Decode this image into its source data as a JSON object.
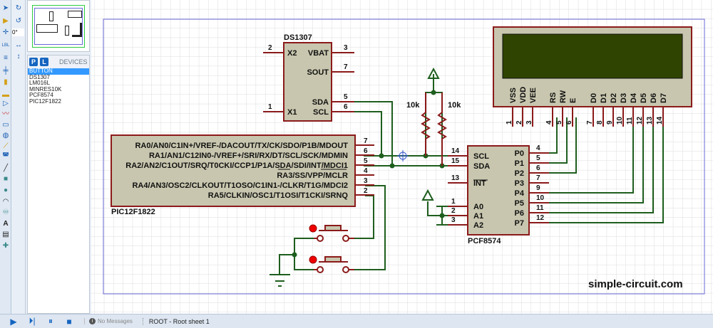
{
  "devices": {
    "title": "DEVICES",
    "p_label": "P",
    "l_label": "L",
    "items": [
      "BUTTON",
      "DS1307",
      "LM016L",
      "MINRES10K",
      "PCF8574",
      "PIC12F1822"
    ],
    "selected": "BUTTON"
  },
  "rotation": "0°",
  "status": {
    "messages": "No Messages",
    "sheet": "ROOT - Root sheet 1"
  },
  "watermark": "simple-circuit.com",
  "colors": {
    "pin": "#8b1a1a",
    "wire": "#1e5e1e",
    "body": "#c8c6ae",
    "lcd_screen": "#2f4400",
    "sheet_border": "#6a6ad8"
  },
  "pic": {
    "name": "PIC12F1822",
    "pins": [
      {
        "label": "RA0/AN0/C1IN+/VREF-/DACOUT/TX/CK/SDO/P1B/MDOUT",
        "num": "7"
      },
      {
        "label": "RA1/AN1/C12IN0-/VREF+/SRI/RX/DT/SCL/SCK/MDMIN",
        "num": "6"
      },
      {
        "label": "RA2/AN2/C1OUT/SRQ/T0CKI/CCP1/P1A/SDA/SDI/INT/MDCI1",
        "num": "5"
      },
      {
        "label": "RA3/SS/VPP/MCLR",
        "num": "4"
      },
      {
        "label": "RA4/AN3/OSC2/CLKOUT/T1OSO/C1IN1-/CLKR/T1G/MDCI2",
        "num": "3"
      },
      {
        "label": "RA5/CLKIN/OSC1/T1OSI/T1CKI/SRNQ",
        "num": "2"
      }
    ]
  },
  "ds1307": {
    "name": "DS1307",
    "left": [
      {
        "label": "X2",
        "num": "2"
      },
      {
        "label": "X1",
        "num": "1"
      }
    ],
    "right": [
      {
        "label": "VBAT",
        "num": "3"
      },
      {
        "label": "SOUT",
        "num": "7"
      },
      {
        "label": "SDA",
        "num": "5"
      },
      {
        "label": "SCL",
        "num": "6"
      }
    ]
  },
  "resistors": [
    "10k",
    "10k"
  ],
  "pcf": {
    "name": "PCF8574",
    "left": [
      {
        "label": "SCL",
        "num": "14"
      },
      {
        "label": "SDA",
        "num": "15"
      },
      {
        "label": "INT",
        "num": "13"
      },
      {
        "label": "A0",
        "num": "1"
      },
      {
        "label": "A1",
        "num": "2"
      },
      {
        "label": "A2",
        "num": "3"
      }
    ],
    "right": [
      {
        "label": "P0",
        "num": "4"
      },
      {
        "label": "P1",
        "num": "5"
      },
      {
        "label": "P2",
        "num": "6"
      },
      {
        "label": "P3",
        "num": "7"
      },
      {
        "label": "P4",
        "num": "9"
      },
      {
        "label": "P5",
        "num": "10"
      },
      {
        "label": "P6",
        "num": "11"
      },
      {
        "label": "P7",
        "num": "12"
      }
    ]
  },
  "lcd": {
    "pins": [
      {
        "label": "VSS",
        "num": "1"
      },
      {
        "label": "VDD",
        "num": "2"
      },
      {
        "label": "VEE",
        "num": "3"
      },
      {
        "label": "RS",
        "num": "4"
      },
      {
        "label": "RW",
        "num": "5"
      },
      {
        "label": "E",
        "num": "6"
      },
      {
        "label": "D0",
        "num": "7"
      },
      {
        "label": "D1",
        "num": "8"
      },
      {
        "label": "D2",
        "num": "9"
      },
      {
        "label": "D3",
        "num": "10"
      },
      {
        "label": "D4",
        "num": "11"
      },
      {
        "label": "D5",
        "num": "12"
      },
      {
        "label": "D6",
        "num": "13"
      },
      {
        "label": "D7",
        "num": "14"
      }
    ]
  }
}
